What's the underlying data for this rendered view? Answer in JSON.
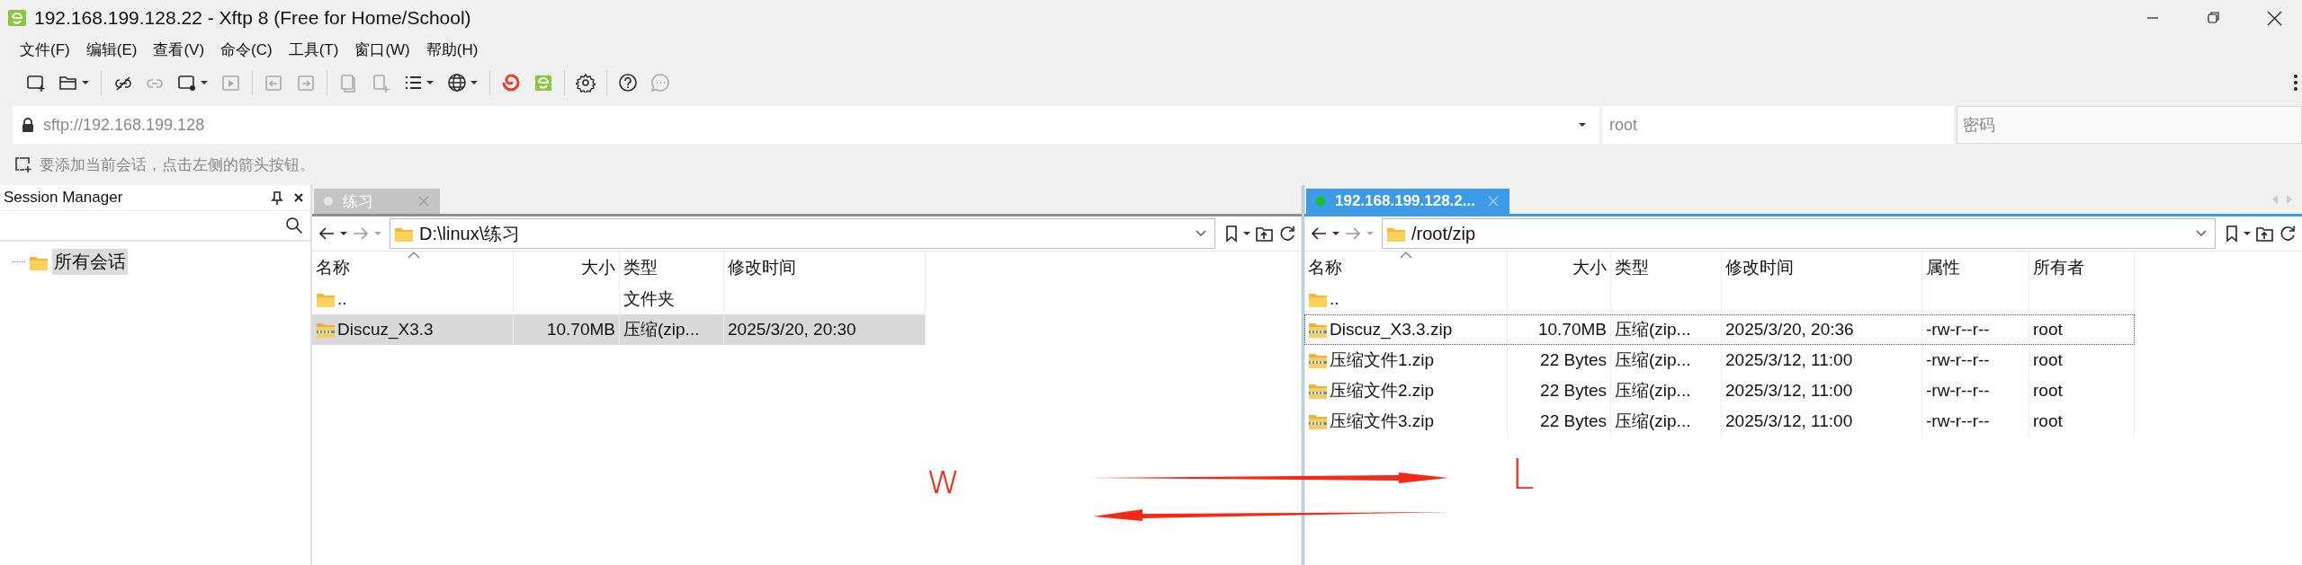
{
  "window": {
    "title": "192.168.199.128.22 - Xftp 8 (Free for Home/School)"
  },
  "menu": [
    "文件(F)",
    "编辑(E)",
    "查看(V)",
    "命令(C)",
    "工具(T)",
    "窗口(W)",
    "帮助(H)"
  ],
  "toolbar": [
    {
      "kind": "new-session",
      "disabled": false,
      "dropdown": false
    },
    {
      "kind": "open-folder",
      "disabled": false,
      "dropdown": true
    },
    {
      "kind": "sep"
    },
    {
      "kind": "unlink",
      "disabled": false,
      "dropdown": false
    },
    {
      "kind": "link",
      "disabled": true,
      "dropdown": false
    },
    {
      "kind": "session-settings",
      "disabled": false,
      "dropdown": true
    },
    {
      "kind": "play",
      "disabled": true,
      "dropdown": false
    },
    {
      "kind": "sep"
    },
    {
      "kind": "transfer-left",
      "disabled": true,
      "dropdown": false
    },
    {
      "kind": "transfer-right",
      "disabled": true,
      "dropdown": false
    },
    {
      "kind": "sep"
    },
    {
      "kind": "copy",
      "disabled": true,
      "dropdown": false
    },
    {
      "kind": "copy-new",
      "disabled": true,
      "dropdown": false
    },
    {
      "kind": "list",
      "disabled": false,
      "dropdown": true
    },
    {
      "kind": "globe",
      "disabled": false,
      "dropdown": true
    },
    {
      "kind": "sep"
    },
    {
      "kind": "swirl",
      "disabled": false,
      "dropdown": false
    },
    {
      "kind": "app",
      "disabled": false,
      "dropdown": false
    },
    {
      "kind": "sep"
    },
    {
      "kind": "gear",
      "disabled": false,
      "dropdown": false
    },
    {
      "kind": "sep"
    },
    {
      "kind": "help",
      "disabled": false,
      "dropdown": false
    },
    {
      "kind": "chat",
      "disabled": true,
      "dropdown": false
    }
  ],
  "address": {
    "url": "sftp://192.168.199.128",
    "user": "root",
    "password_placeholder": "密码"
  },
  "hint": "要添加当前会话，点击左侧的箭头按钮。",
  "session_manager": {
    "title": "Session Manager",
    "tree": [
      {
        "label": "所有会话",
        "selected": true
      }
    ]
  },
  "panes": [
    {
      "tab": {
        "label": "练习",
        "connected": false,
        "selected": false
      },
      "path": "D:\\linux\\练习",
      "columns": [
        {
          "label": "名称",
          "sorted": true
        },
        {
          "label": "大小",
          "sorted": false
        },
        {
          "label": "类型",
          "sorted": false
        },
        {
          "label": "修改时间",
          "sorted": false
        }
      ],
      "rows": [
        {
          "kind": "folder",
          "selected": false,
          "focused": false,
          "cells": [
            "..",
            null,
            "文件夹",
            null
          ]
        },
        {
          "kind": "zip",
          "selected": true,
          "focused": false,
          "cells": [
            "Discuz_X3.3",
            "10.70MB",
            "压缩(zip...",
            "2025/3/20, 20:30"
          ]
        }
      ]
    },
    {
      "tab": {
        "label": "192.168.199.128.2...",
        "connected": true,
        "selected": true
      },
      "path": "/root/zip",
      "columns": [
        {
          "label": "名称",
          "sorted": true
        },
        {
          "label": "大小",
          "sorted": false
        },
        {
          "label": "类型",
          "sorted": false
        },
        {
          "label": "修改时间",
          "sorted": false
        },
        {
          "label": "属性",
          "sorted": false
        },
        {
          "label": "所有者",
          "sorted": false
        }
      ],
      "rows": [
        {
          "kind": "folder",
          "selected": false,
          "focused": false,
          "cells": [
            "..",
            null,
            null,
            null,
            null,
            null
          ]
        },
        {
          "kind": "zip",
          "selected": false,
          "focused": true,
          "cells": [
            "Discuz_X3.3.zip",
            "10.70MB",
            "压缩(zip...",
            "2025/3/20, 20:36",
            "-rw-r--r--",
            "root"
          ]
        },
        {
          "kind": "zip",
          "selected": false,
          "focused": false,
          "cells": [
            "压缩文件1.zip",
            "22 Bytes",
            "压缩(zip...",
            "2025/3/12, 11:00",
            "-rw-r--r--",
            "root"
          ]
        },
        {
          "kind": "zip",
          "selected": false,
          "focused": false,
          "cells": [
            "压缩文件2.zip",
            "22 Bytes",
            "压缩(zip...",
            "2025/3/12, 11:00",
            "-rw-r--r--",
            "root"
          ]
        },
        {
          "kind": "zip",
          "selected": false,
          "focused": false,
          "cells": [
            "压缩文件3.zip",
            "22 Bytes",
            "压缩(zip...",
            "2025/3/12, 11:00",
            "-rw-r--r--",
            "root"
          ]
        }
      ]
    }
  ],
  "annotations": [
    {
      "kind": "letter",
      "text": "w"
    },
    {
      "kind": "arrow-right"
    },
    {
      "kind": "arrow-left"
    },
    {
      "kind": "letter",
      "text": "L"
    }
  ]
}
